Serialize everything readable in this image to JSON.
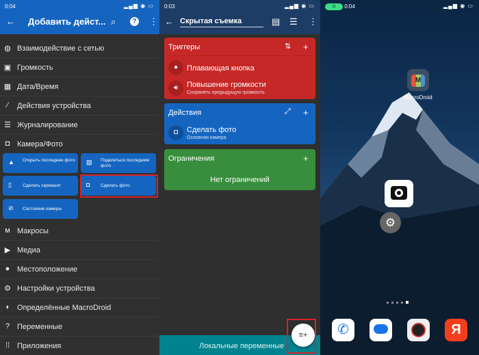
{
  "left": {
    "status": {
      "time": "0:04",
      "battery": "23"
    },
    "header": {
      "title": "Добавить дейст...",
      "back_icon": "arrow-left-icon",
      "search_icon": "search-icon",
      "help_icon": "help-icon",
      "more_icon": "more-vert-icon"
    },
    "categories": [
      {
        "label": "Взаимодействие с сетью",
        "icon": "globe-icon"
      },
      {
        "label": "Громкость",
        "icon": "speaker-icon"
      },
      {
        "label": "Дата/Время",
        "icon": "calendar-clock-icon"
      },
      {
        "label": "Действия устройства",
        "icon": "magic-wand-icon"
      },
      {
        "label": "Журналирование",
        "icon": "list-icon"
      },
      {
        "label": "Камера/Фото",
        "icon": "camera-icon"
      }
    ],
    "camera_actions": [
      {
        "label": "Открыть последнее фото",
        "icon": "photo-icon"
      },
      {
        "label": "Поделиться последним фото",
        "icon": "image-icon"
      },
      {
        "label": "Сделать скриншот",
        "icon": "phone-icon"
      },
      {
        "label": "Сделать фото",
        "icon": "camera-icon"
      },
      {
        "label": "Состояние камеры",
        "icon": "camera-off-icon"
      }
    ],
    "categories_after": [
      {
        "label": "Макросы",
        "icon": "macro-icon"
      },
      {
        "label": "Медиа",
        "icon": "play-icon"
      },
      {
        "label": "Местоположение",
        "icon": "location-icon"
      },
      {
        "label": "Настройки устройства",
        "icon": "settings-icon"
      },
      {
        "label": "Определённые MacroDroid",
        "icon": "android-icon"
      },
      {
        "label": "Переменные",
        "icon": "variable-icon"
      },
      {
        "label": "Приложения",
        "icon": "apps-icon"
      }
    ]
  },
  "middle": {
    "status": {
      "time": "0:03",
      "battery": "23"
    },
    "header": {
      "macro_name": "Скрытая съемка"
    },
    "triggers": {
      "title": "Триггеры",
      "items": [
        {
          "label": "Плавающая кнопка",
          "sub": ""
        },
        {
          "label": "Повышение громкости",
          "sub": "Сохранять предыдущую громкость"
        }
      ],
      "color": "#c62828"
    },
    "actions": {
      "title": "Действия",
      "items": [
        {
          "label": "Сделать фото",
          "sub": "Основная камера"
        }
      ],
      "color": "#1565c0"
    },
    "constraints": {
      "title": "Ограничения",
      "empty": "Нет ограничений",
      "color": "#388e3c"
    },
    "bottom": {
      "label": "Локальные переменные",
      "color": "#00838f"
    }
  },
  "right": {
    "status": {
      "time": "0:04",
      "battery": "23"
    },
    "app_icon_label": "MacroDroid",
    "dock": [
      "phone-icon",
      "messages-icon",
      "camera-app-icon",
      "yandex-icon"
    ],
    "yandex_letter": "Я",
    "page_count": 5,
    "active_page": 5
  }
}
